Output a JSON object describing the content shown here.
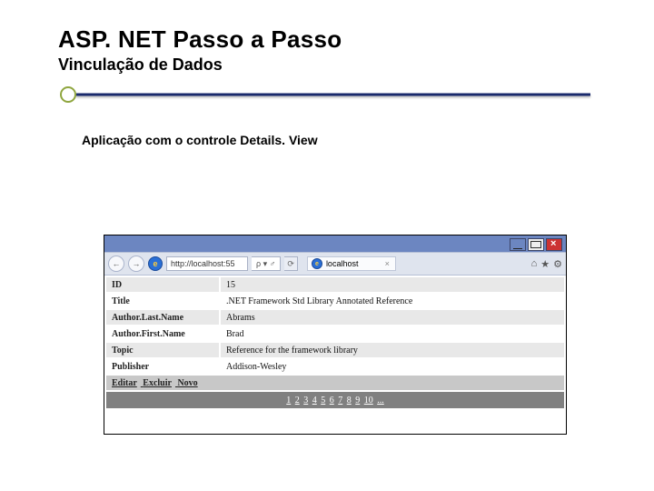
{
  "heading": {
    "title": "ASP. NET Passo a Passo",
    "subtitle": "Vinculação de Dados"
  },
  "body_label": "Aplicação com o controle Details. View",
  "browser": {
    "url": "http://localhost:55",
    "url_suffix": "ρ ▾  ♂",
    "refresh_glyph": "⟳",
    "tab_label": "localhost",
    "tab_close": "×",
    "icons": {
      "back": "←",
      "forward": "→",
      "ie": "e",
      "home": "⌂",
      "star": "★",
      "gear": "⚙"
    }
  },
  "details": {
    "rows": [
      {
        "key": "ID",
        "val": "15"
      },
      {
        "key": "Title",
        "val": ".NET Framework Std Library Annotated Reference"
      },
      {
        "key": "Author.Last.Name",
        "val": "Abrams"
      },
      {
        "key": "Author.First.Name",
        "val": "Brad"
      },
      {
        "key": "Topic",
        "val": "Reference for the framework library"
      },
      {
        "key": "Publisher",
        "val": "Addison-Wesley"
      }
    ],
    "actions": {
      "edit": "Editar",
      "delete": "Excluir",
      "new_": "Novo"
    },
    "pager": {
      "pages": [
        "1",
        "2",
        "3",
        "4",
        "5",
        "6",
        "7",
        "8",
        "9",
        "10"
      ],
      "more": "..."
    }
  }
}
